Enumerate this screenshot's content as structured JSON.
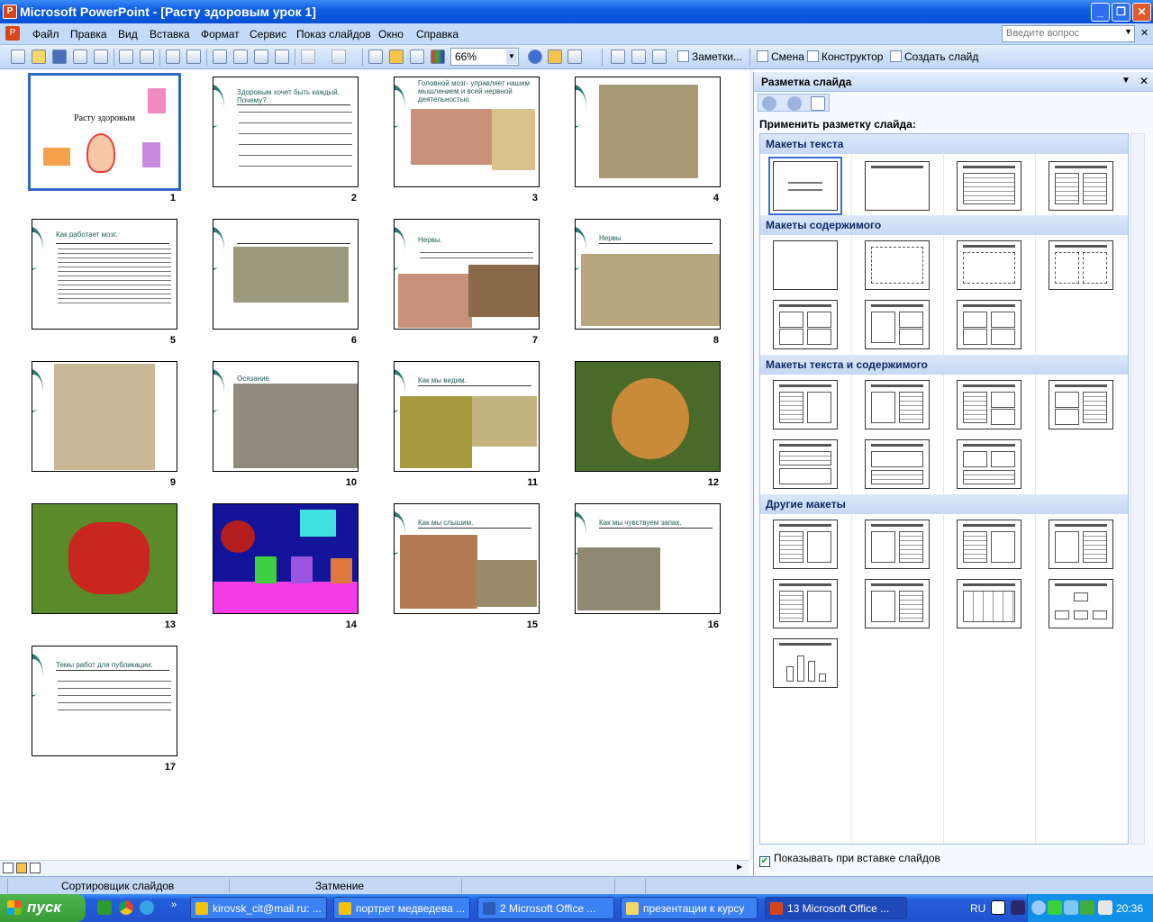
{
  "window": {
    "title": "Microsoft PowerPoint - [Расту здоровым урок 1]"
  },
  "menu": {
    "items": [
      "Файл",
      "Правка",
      "Вид",
      "Вставка",
      "Формат",
      "Сервис",
      "Показ слайдов",
      "Окно",
      "Справка"
    ],
    "ask_placeholder": "Введите вопрос"
  },
  "toolbar": {
    "zoom": "66%",
    "notes": "Заметки...",
    "transition": "Смена",
    "designer": "Конструктор",
    "new_slide": "Создать слайд"
  },
  "slides": [
    {
      "n": "1",
      "title": "Расту здоровым"
    },
    {
      "n": "2",
      "title": "Здоровым хочет быть каждый. Почему?"
    },
    {
      "n": "3",
      "title": "Головной мозг- управляет нашим мышлением и всей нервной деятельностью."
    },
    {
      "n": "4",
      "title": ""
    },
    {
      "n": "5",
      "title": "Как работает мозг."
    },
    {
      "n": "6",
      "title": ""
    },
    {
      "n": "7",
      "title": "Нервы."
    },
    {
      "n": "8",
      "title": "Нервы"
    },
    {
      "n": "9",
      "title": ""
    },
    {
      "n": "10",
      "title": "Осязание"
    },
    {
      "n": "11",
      "title": "Как мы видим."
    },
    {
      "n": "12",
      "title": ""
    },
    {
      "n": "13",
      "title": ""
    },
    {
      "n": "14",
      "title": ""
    },
    {
      "n": "15",
      "title": "Как мы слышим."
    },
    {
      "n": "16",
      "title": "Как мы чувствуем запах."
    },
    {
      "n": "17",
      "title": "Темы работ для публикации:"
    }
  ],
  "pane": {
    "title": "Разметка слайда",
    "apply_label": "Применить разметку слайда:",
    "sections": [
      "Макеты текста",
      "Макеты содержимого",
      "Макеты текста и содержимого",
      "Другие макеты"
    ],
    "show_on_insert": "Показывать при вставке слайдов"
  },
  "status": {
    "view": "Сортировщик слайдов",
    "design": "Затмение"
  },
  "taskbar": {
    "start": "пуск",
    "tasks": [
      "kirovsk_cit@mail.ru: ...",
      "портрет медведева ...",
      "2 Microsoft Office ...",
      "презентации к курсу",
      "13 Microsoft Office ..."
    ],
    "lang": "RU",
    "clock": "20:36"
  },
  "colors": {
    "title_bar": "#0550d6",
    "accent_teal": "#2f7a70",
    "selection": "#3167c8"
  }
}
